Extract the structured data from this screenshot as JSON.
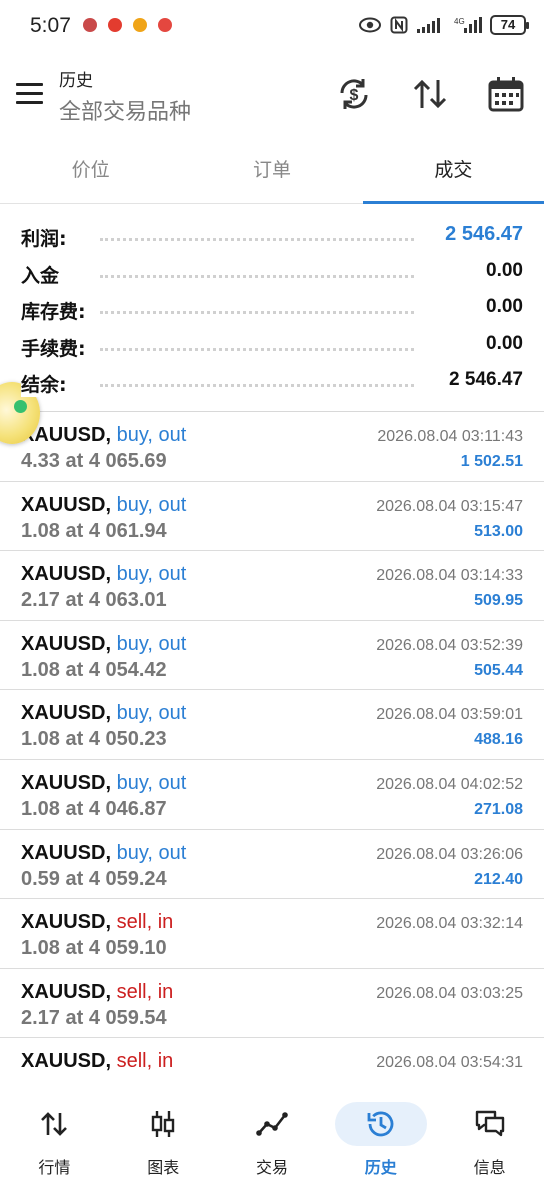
{
  "status_bar": {
    "time": "5:07",
    "battery": "74"
  },
  "header": {
    "title": "历史",
    "subtitle": "全部交易品种"
  },
  "tabs": [
    {
      "label": "价位",
      "active": false
    },
    {
      "label": "订单",
      "active": false
    },
    {
      "label": "成交",
      "active": true
    }
  ],
  "summary": [
    {
      "label": "利润:",
      "value": "2 546.47",
      "highlight": true
    },
    {
      "label": "入金",
      "value": "0.00",
      "highlight": false
    },
    {
      "label": "库存费:",
      "value": "0.00",
      "highlight": false
    },
    {
      "label": "手续费:",
      "value": "0.00",
      "highlight": false
    },
    {
      "label": "结余:",
      "value": "2 546.47",
      "highlight": false
    }
  ],
  "deals": [
    {
      "symbol": "XAUUSD,",
      "type": "buy, out",
      "side": "buy",
      "volume_price": "4.33 at 4 065.69",
      "time": "2026.08.04 03:11:43",
      "profit": "1 502.51"
    },
    {
      "symbol": "XAUUSD,",
      "type": "buy, out",
      "side": "buy",
      "volume_price": "1.08 at 4 061.94",
      "time": "2026.08.04 03:15:47",
      "profit": "513.00"
    },
    {
      "symbol": "XAUUSD,",
      "type": "buy, out",
      "side": "buy",
      "volume_price": "2.17 at 4 063.01",
      "time": "2026.08.04 03:14:33",
      "profit": "509.95"
    },
    {
      "symbol": "XAUUSD,",
      "type": "buy, out",
      "side": "buy",
      "volume_price": "1.08 at 4 054.42",
      "time": "2026.08.04 03:52:39",
      "profit": "505.44"
    },
    {
      "symbol": "XAUUSD,",
      "type": "buy, out",
      "side": "buy",
      "volume_price": "1.08 at 4 050.23",
      "time": "2026.08.04 03:59:01",
      "profit": "488.16"
    },
    {
      "symbol": "XAUUSD,",
      "type": "buy, out",
      "side": "buy",
      "volume_price": "1.08 at 4 046.87",
      "time": "2026.08.04 04:02:52",
      "profit": "271.08"
    },
    {
      "symbol": "XAUUSD,",
      "type": "buy, out",
      "side": "buy",
      "volume_price": "0.59 at 4 059.24",
      "time": "2026.08.04 03:26:06",
      "profit": "212.40"
    },
    {
      "symbol": "XAUUSD,",
      "type": "sell, in",
      "side": "sell",
      "volume_price": "1.08 at 4 059.10",
      "time": "2026.08.04 03:32:14",
      "profit": ""
    },
    {
      "symbol": "XAUUSD,",
      "type": "sell, in",
      "side": "sell",
      "volume_price": "2.17 at 4 059.54",
      "time": "2026.08.04 03:03:25",
      "profit": ""
    },
    {
      "symbol": "XAUUSD,",
      "type": "sell, in",
      "side": "sell",
      "volume_price": "",
      "time": "2026.08.04 03:54:31",
      "profit": ""
    }
  ],
  "bottom_nav": [
    {
      "label": "行情",
      "icon": "arrows-updown-icon",
      "active": false
    },
    {
      "label": "图表",
      "icon": "candlestick-icon",
      "active": false
    },
    {
      "label": "交易",
      "icon": "trade-line-icon",
      "active": false
    },
    {
      "label": "历史",
      "icon": "history-clock-icon",
      "active": true
    },
    {
      "label": "信息",
      "icon": "chat-bubbles-icon",
      "active": false
    }
  ],
  "colors": {
    "accent": "#2b7fd4",
    "sell": "#cc1f1f",
    "muted": "#777777"
  }
}
